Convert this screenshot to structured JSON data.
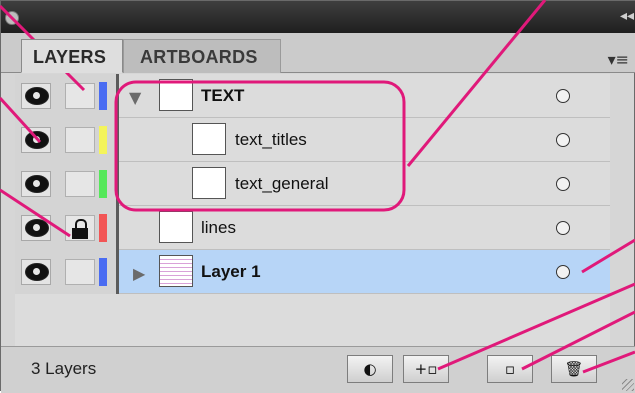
{
  "window": {
    "collapse_glyph": "◂◂"
  },
  "tabs": [
    {
      "label": "LAYERS",
      "active": true
    },
    {
      "label": "ARTBOARDS",
      "active": false
    }
  ],
  "panel_menu_glyph": "▾≡",
  "layers": [
    {
      "name": "TEXT",
      "bold": true,
      "indent": 0,
      "disclosure": "expanded",
      "color": "#4a6cf2",
      "locked": false,
      "selected": false
    },
    {
      "name": "text_titles",
      "bold": false,
      "indent": 1,
      "disclosure": "none",
      "color": "#f4f45a",
      "locked": false,
      "selected": false
    },
    {
      "name": "text_general",
      "bold": false,
      "indent": 1,
      "disclosure": "none",
      "color": "#55e85a",
      "locked": false,
      "selected": false
    },
    {
      "name": "lines",
      "bold": false,
      "indent": 0,
      "disclosure": "none",
      "color": "#f25555",
      "locked": true,
      "selected": false
    },
    {
      "name": "Layer 1",
      "bold": true,
      "indent": 0,
      "disclosure": "collapsed",
      "color": "#4a6cf2",
      "locked": false,
      "selected": true
    }
  ],
  "footer": {
    "layer_count": "3 Layers",
    "buttons": [
      {
        "name": "make-clipping-mask",
        "glyph": "◐"
      },
      {
        "name": "create-new-sublayer",
        "glyph": "+▫"
      },
      {
        "name": "create-new-layer",
        "glyph": "▫"
      },
      {
        "name": "delete-selection",
        "glyph": "🗑"
      }
    ]
  },
  "annotation_color": "#e0197a"
}
